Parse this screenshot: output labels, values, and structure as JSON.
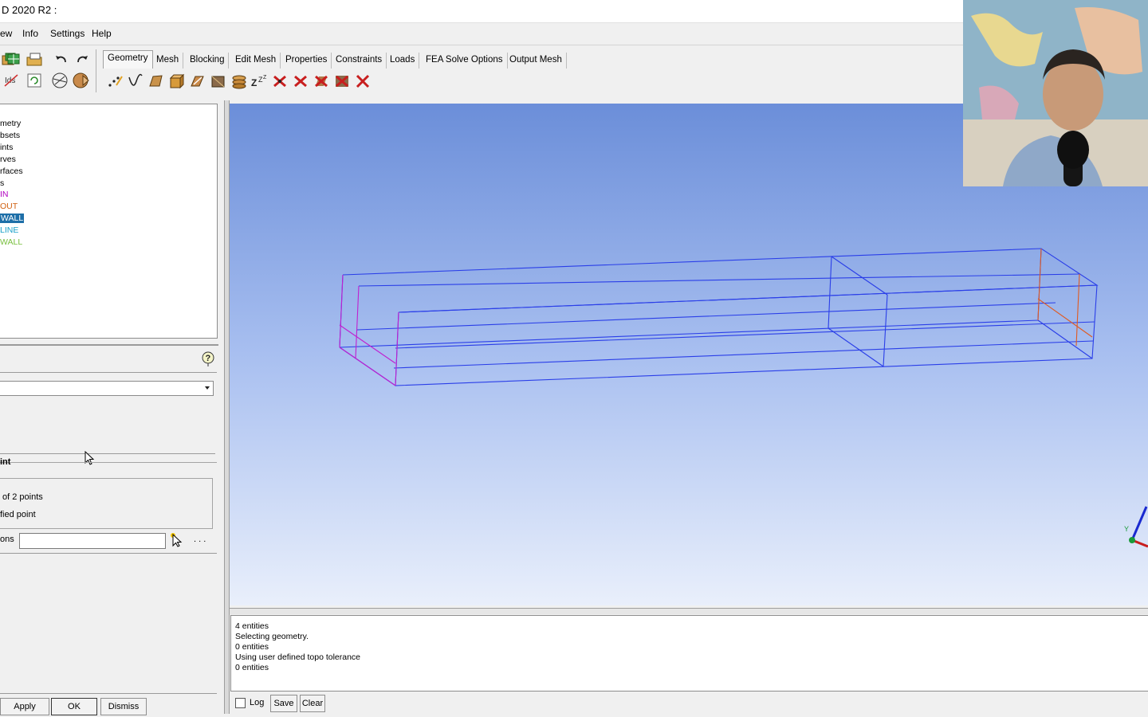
{
  "window": {
    "title": "D 2020 R2 :"
  },
  "menu": [
    "ew",
    "Info",
    "Settings",
    "Help"
  ],
  "tabs": [
    "Geometry",
    "Mesh",
    "Blocking",
    "Edit Mesh",
    "Properties",
    "Constraints",
    "Loads",
    "FEA Solve Options",
    "Output Mesh"
  ],
  "active_tab": "Geometry",
  "tree": {
    "items": [
      {
        "label": "metry",
        "color": "#000000"
      },
      {
        "label": "bsets",
        "color": "#000000"
      },
      {
        "label": "ints",
        "color": "#000000"
      },
      {
        "label": "rves",
        "color": "#000000"
      },
      {
        "label": "rfaces",
        "color": "#000000"
      },
      {
        "label": "s",
        "color": "#000000"
      },
      {
        "label": "IN",
        "color": "#b000c0"
      },
      {
        "label": "OUT",
        "color": "#d06010"
      },
      {
        "label": "WALL",
        "color": "#ffffff"
      },
      {
        "label": "LINE",
        "color": "#1aa0c8"
      },
      {
        "label": "WALL",
        "color": "#7ac040"
      }
    ],
    "selected_index": 8,
    "selected_bg": "#1e6fa8"
  },
  "form": {
    "group_label": "int",
    "option1": "of 2 points",
    "option2": "fied point",
    "field_label": "ons",
    "field_value": "",
    "more_label": ". . ."
  },
  "buttons": {
    "apply": "Apply",
    "ok": "OK",
    "dismiss": "Dismiss"
  },
  "messages": [
    "4 entities",
    "Selecting geometry.",
    "0 entities",
    "Using user defined topo tolerance",
    "0 entities"
  ],
  "msg_controls": {
    "log": "Log",
    "save": "Save",
    "clear": "Clear"
  },
  "axis": {
    "y_label": "Y"
  },
  "colors": {
    "wire_blue": "#2a3ee8",
    "wire_magenta": "#c020d0",
    "wire_orange": "#e05a20"
  }
}
